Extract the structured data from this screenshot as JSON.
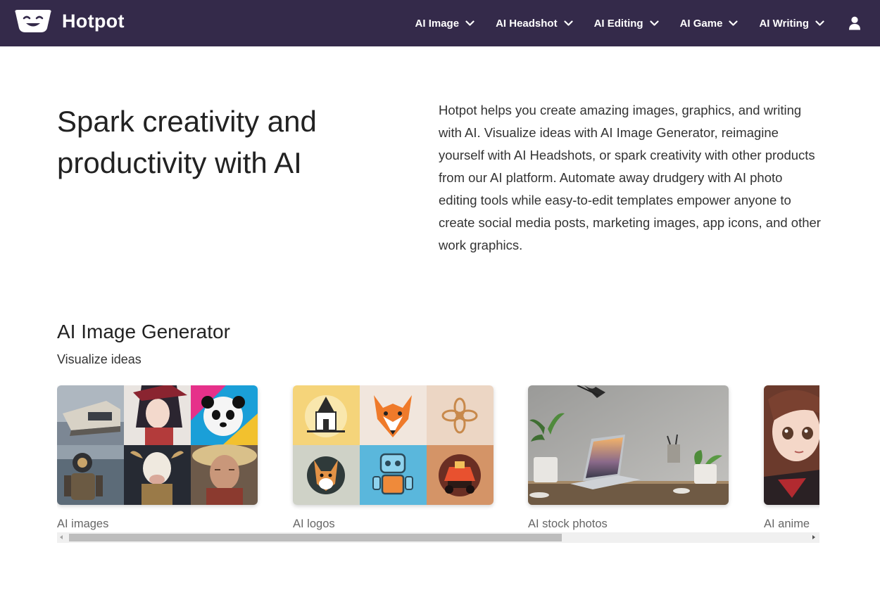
{
  "header": {
    "brand": "Hotpot",
    "nav": [
      {
        "label": "AI Image"
      },
      {
        "label": "AI Headshot"
      },
      {
        "label": "AI Editing"
      },
      {
        "label": "AI Game"
      },
      {
        "label": "AI Writing"
      }
    ],
    "icons": {
      "logo": "hotpot-face-logo",
      "chevron": "chevron-down-icon",
      "user": "user-icon"
    },
    "colors": {
      "bar": "#342a4a",
      "text": "#ffffff"
    }
  },
  "hero": {
    "title": "Spark creativity and productivity with AI",
    "description": "Hotpot helps you create amazing images, graphics, and writing with AI. Visualize ideas with AI Image Generator, reimagine yourself with AI Headshots, or spark creativity with other products from our AI platform. Automate away drudgery with AI photo editing tools while easy-to-edit templates empower anyone to create social media posts, marketing images, app icons, and other work graphics."
  },
  "section": {
    "title": "AI Image Generator",
    "subtitle": "Visualize ideas",
    "cards": [
      {
        "label": "AI images"
      },
      {
        "label": "AI logos"
      },
      {
        "label": "AI stock photos"
      },
      {
        "label": "AI anime"
      }
    ]
  }
}
